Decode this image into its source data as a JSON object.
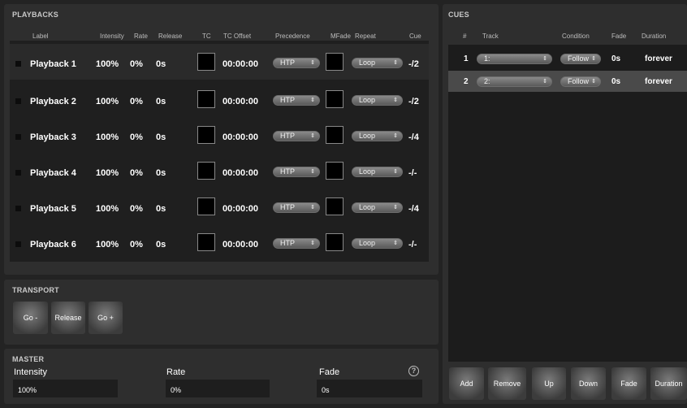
{
  "playbacks": {
    "title": "PLAYBACKS",
    "headers": {
      "label": "Label",
      "intensity": "Intensity",
      "rate": "Rate",
      "release": "Release",
      "tc": "TC",
      "tc_offset": "TC Offset",
      "precedence": "Precedence",
      "mfade": "MFade",
      "repeat": "Repeat",
      "cue": "Cue"
    },
    "rows": [
      {
        "label": "Playback 1",
        "intensity": "100%",
        "rate": "0%",
        "release": "0s",
        "tc_offset": "00:00:00",
        "precedence": "HTP",
        "repeat": "Loop",
        "cue": "-/2"
      },
      {
        "label": "Playback 2",
        "intensity": "100%",
        "rate": "0%",
        "release": "0s",
        "tc_offset": "00:00:00",
        "precedence": "HTP",
        "repeat": "Loop",
        "cue": "-/2"
      },
      {
        "label": "Playback 3",
        "intensity": "100%",
        "rate": "0%",
        "release": "0s",
        "tc_offset": "00:00:00",
        "precedence": "HTP",
        "repeat": "Loop",
        "cue": "-/4"
      },
      {
        "label": "Playback 4",
        "intensity": "100%",
        "rate": "0%",
        "release": "0s",
        "tc_offset": "00:00:00",
        "precedence": "HTP",
        "repeat": "Loop",
        "cue": "-/-"
      },
      {
        "label": "Playback 5",
        "intensity": "100%",
        "rate": "0%",
        "release": "0s",
        "tc_offset": "00:00:00",
        "precedence": "HTP",
        "repeat": "Loop",
        "cue": "-/4"
      },
      {
        "label": "Playback 6",
        "intensity": "100%",
        "rate": "0%",
        "release": "0s",
        "tc_offset": "00:00:00",
        "precedence": "HTP",
        "repeat": "Loop",
        "cue": "-/-"
      }
    ]
  },
  "transport": {
    "title": "TRANSPORT",
    "buttons": {
      "go_minus": "Go -",
      "release": "Release",
      "go_plus": "Go +"
    }
  },
  "master": {
    "title": "MASTER",
    "intensity_label": "Intensity",
    "intensity_value": "100%",
    "rate_label": "Rate",
    "rate_value": "0%",
    "fade_label": "Fade",
    "fade_value": "0s",
    "help_icon": "?"
  },
  "cues": {
    "title": "CUES",
    "headers": {
      "num": "#",
      "track": "Track",
      "condition": "Condition",
      "fade": "Fade",
      "duration": "Duration"
    },
    "rows": [
      {
        "num": "1",
        "track": "1:",
        "condition": "Follow",
        "fade": "0s",
        "duration": "forever"
      },
      {
        "num": "2",
        "track": "2:",
        "condition": "Follow",
        "fade": "0s",
        "duration": "forever"
      }
    ],
    "buttons": {
      "add": "Add",
      "remove": "Remove",
      "up": "Up",
      "down": "Down",
      "fade": "Fade",
      "duration": "Duration"
    }
  },
  "icons": {
    "select_arrow": "⇕"
  }
}
